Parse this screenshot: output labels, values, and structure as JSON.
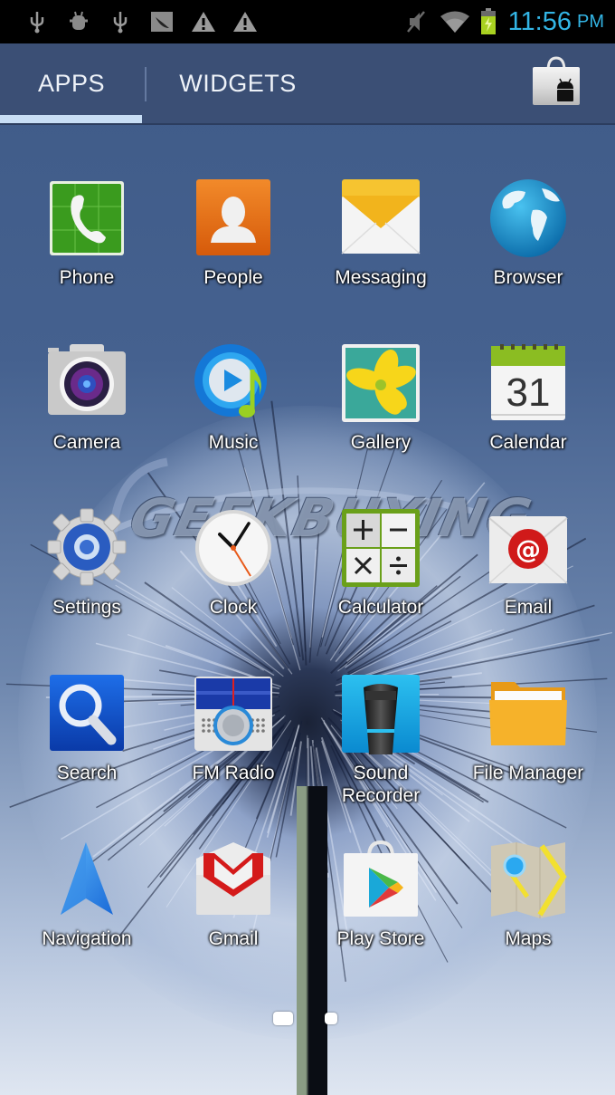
{
  "status_bar": {
    "left_icons": [
      "usb-icon",
      "android-debug-icon",
      "usb-icon",
      "screenshot-icon",
      "warning-icon",
      "warning-icon"
    ],
    "right_icons": [
      "mute-icon",
      "wifi-icon",
      "battery-charging-icon"
    ],
    "time": "11:56",
    "ampm": "PM",
    "accent_color": "#33b5e5"
  },
  "tabs": [
    {
      "label": "APPS",
      "selected": true
    },
    {
      "label": "WIDGETS",
      "selected": false
    }
  ],
  "store_button": {
    "icon": "play-store-bag-icon"
  },
  "apps": [
    {
      "label": "Phone",
      "icon": "phone-icon"
    },
    {
      "label": "People",
      "icon": "people-icon"
    },
    {
      "label": "Messaging",
      "icon": "messaging-icon"
    },
    {
      "label": "Browser",
      "icon": "browser-icon"
    },
    {
      "label": "Camera",
      "icon": "camera-icon"
    },
    {
      "label": "Music",
      "icon": "music-icon"
    },
    {
      "label": "Gallery",
      "icon": "gallery-icon"
    },
    {
      "label": "Calendar",
      "icon": "calendar-icon",
      "day": "31"
    },
    {
      "label": "Settings",
      "icon": "settings-icon"
    },
    {
      "label": "Clock",
      "icon": "clock-icon"
    },
    {
      "label": "Calculator",
      "icon": "calculator-icon"
    },
    {
      "label": "Email",
      "icon": "email-icon"
    },
    {
      "label": "Search",
      "icon": "search-icon"
    },
    {
      "label": "FM Radio",
      "icon": "fm-radio-icon"
    },
    {
      "label": "Sound\nRecorder",
      "icon": "sound-recorder-icon"
    },
    {
      "label": "File Manager",
      "icon": "file-manager-icon"
    },
    {
      "label": "Navigation",
      "icon": "navigation-icon"
    },
    {
      "label": "Gmail",
      "icon": "gmail-icon"
    },
    {
      "label": "Play Store",
      "icon": "play-store-icon"
    },
    {
      "label": "Maps",
      "icon": "maps-icon"
    }
  ],
  "pager": {
    "pages": 2,
    "current": 1
  },
  "watermark": "GEEKBUYING"
}
